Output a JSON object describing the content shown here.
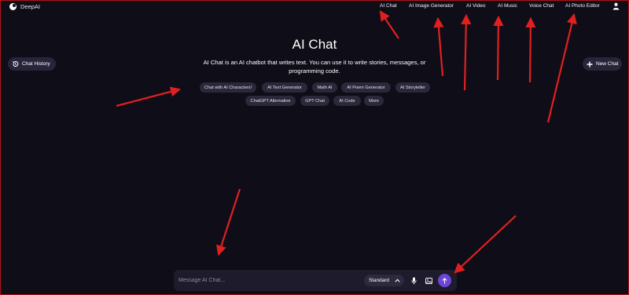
{
  "brand": {
    "name": "DeepAI"
  },
  "nav": {
    "items": [
      {
        "label": "AI Chat"
      },
      {
        "label": "AI Image Generator"
      },
      {
        "label": "AI Video"
      },
      {
        "label": "AI Music"
      },
      {
        "label": "Voice Chat"
      },
      {
        "label": "AI Photo Editor"
      }
    ]
  },
  "sidebar": {
    "history_label": "Chat History",
    "new_chat_label": "New Chat"
  },
  "hero": {
    "title": "AI Chat",
    "subtitle": "AI Chat is an AI chatbot that writes text. You can use it to write stories, messages, or programming code."
  },
  "chips": [
    {
      "label": "Chat with AI Characters!"
    },
    {
      "label": "AI Text Generator"
    },
    {
      "label": "Math AI"
    },
    {
      "label": "AI Poem Generator"
    },
    {
      "label": "AI Storyteller"
    },
    {
      "label": "ChatGPT Alternative"
    },
    {
      "label": "GPT Chat"
    },
    {
      "label": "AI Code"
    },
    {
      "label": "More"
    }
  ],
  "composer": {
    "placeholder": "Message AI Chat...",
    "mode": "Standard"
  },
  "annotations": {
    "arrow_color": "#e02020"
  },
  "icons": {
    "brand": "deepai-logo-icon",
    "user": "user-icon",
    "history": "history-icon",
    "new_chat": "plus-icon",
    "mode": "chevron-up-icon",
    "voice": "microphone-icon",
    "image": "image-icon",
    "send": "arrow-up-icon"
  }
}
